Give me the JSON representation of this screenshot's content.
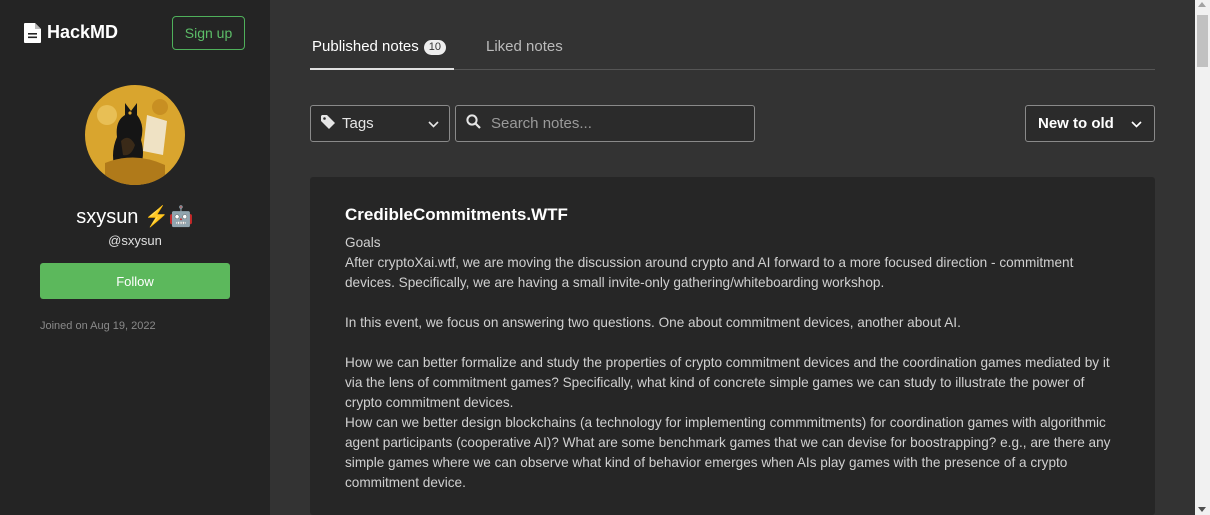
{
  "brand": {
    "name": "HackMD",
    "icon": "file-icon"
  },
  "header": {
    "signup_label": "Sign up"
  },
  "profile": {
    "name": "sxysun ⚡🤖",
    "handle": "@sxysun",
    "follow_label": "Follow",
    "joined": "Joined on Aug 19, 2022"
  },
  "tabs": [
    {
      "label": "Published notes",
      "count": "10",
      "active": true
    },
    {
      "label": "Liked notes",
      "active": false
    }
  ],
  "filters": {
    "tags_label": "Tags",
    "search_placeholder": "Search notes...",
    "sort_label": "New to old"
  },
  "note": {
    "title": "CredibleCommitments.WTF",
    "lines": [
      "Goals",
      "After cryptoXai.wtf, we are moving the discussion around crypto and AI forward to a more focused direction - commitment devices. Specifically, we are having a small invite-only gathering/whiteboarding workshop.",
      "",
      "In this event, we focus on answering two questions. One about commitment devices, another about AI.",
      "",
      "How we can better formalize and study the properties of crypto commitment devices and the coordination games mediated by it via the lens of commitment games? Specifically, what kind of concrete simple games we can study to illustrate the power of crypto commitment devices.",
      "How can we better design blockchains (a technology for implementing commmitments) for coordination games with algorithmic agent participants (cooperative AI)? What are some benchmark games that we can devise for boostrapping? e.g., are there any simple games where we can observe what kind of behavior emerges when AIs play games with the presence of a crypto commitment device."
    ]
  },
  "colors": {
    "accent_green": "#5cb85c",
    "sidebar_bg": "#242424",
    "main_bg": "#333333",
    "card_bg": "#262626"
  }
}
